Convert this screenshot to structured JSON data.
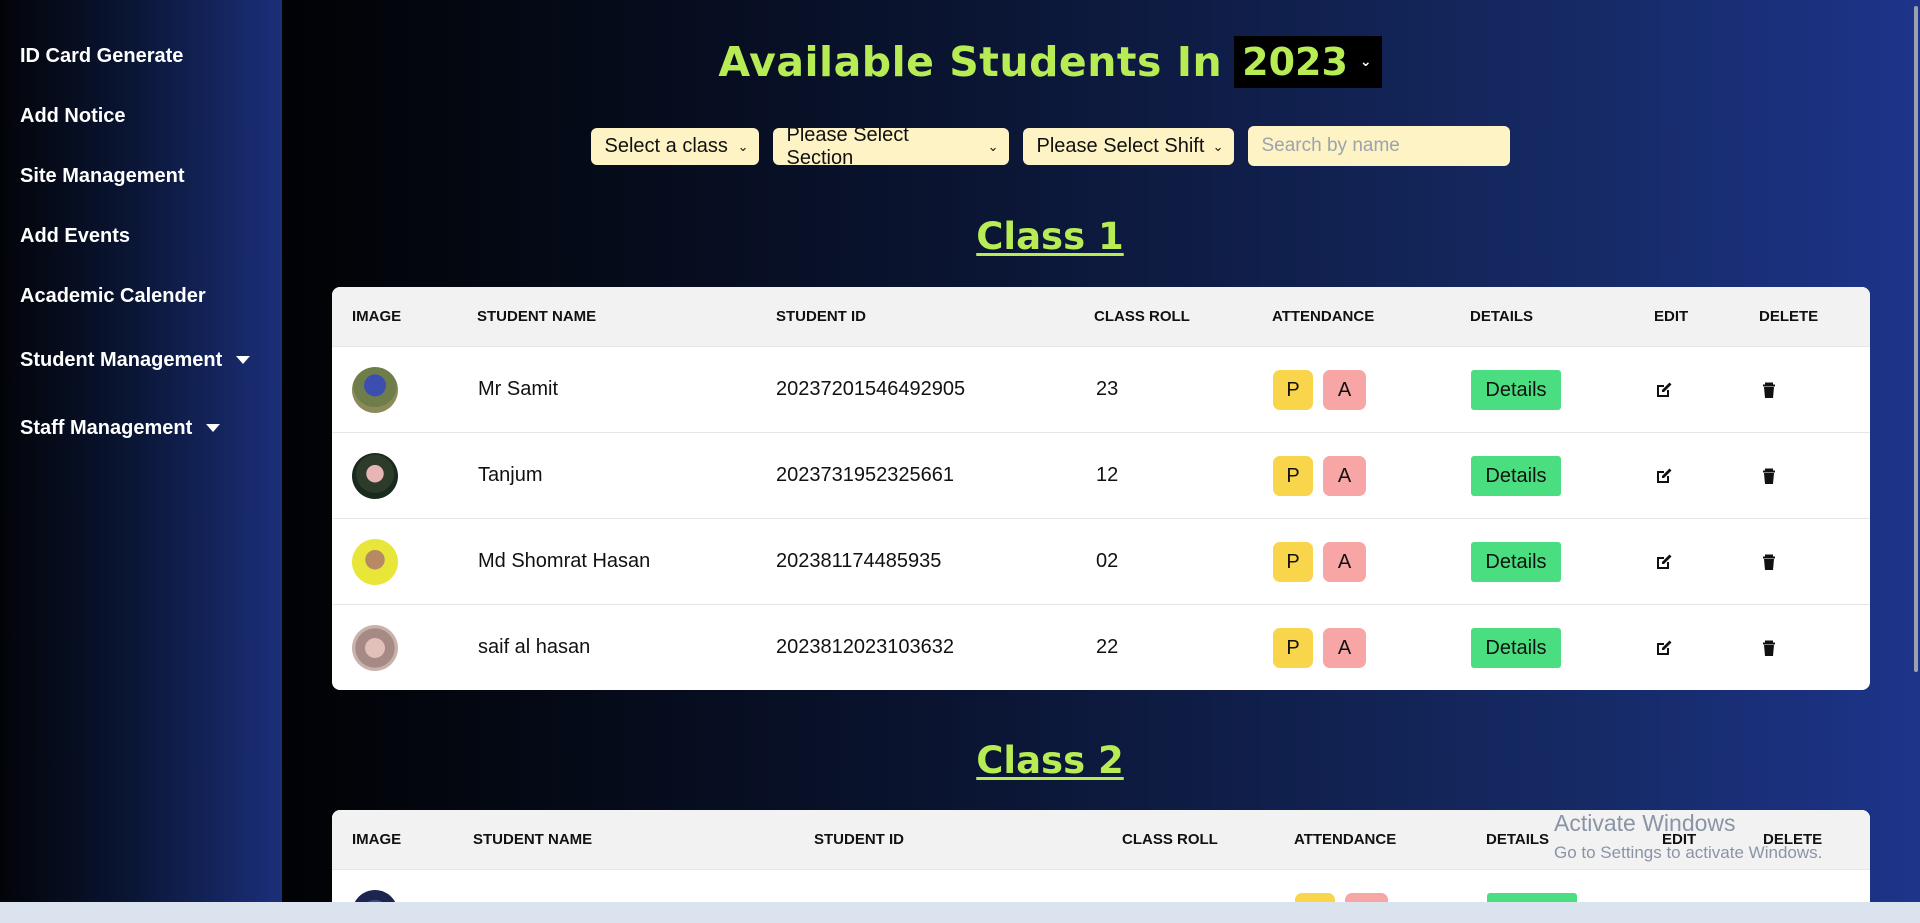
{
  "sidebar": {
    "items": [
      {
        "label": "ID Card Generate"
      },
      {
        "label": "Add Notice"
      },
      {
        "label": "Site Management"
      },
      {
        "label": "Add Events"
      },
      {
        "label": "Academic Calender"
      },
      {
        "label": "Student Management"
      },
      {
        "label": "Staff Management"
      }
    ]
  },
  "header": {
    "title": "Available Students In",
    "year": "2023"
  },
  "filters": {
    "class_select": "Select a class",
    "section_select": "Please Select Section",
    "shift_select": "Please Select Shift",
    "search_placeholder": "Search by name"
  },
  "columns": [
    "IMAGE",
    "STUDENT NAME",
    "STUDENT ID",
    "CLASS ROLL",
    "ATTENDANCE",
    "DETAILS",
    "EDIT",
    "DELETE"
  ],
  "class1": {
    "title": "Class 1",
    "rows": [
      {
        "name": "Mr Samit",
        "id": "20237201546492905",
        "roll": "23"
      },
      {
        "name": "Tanjum",
        "id": "2023731952325661",
        "roll": "12"
      },
      {
        "name": "Md Shomrat Hasan",
        "id": "202381174485935",
        "roll": "02"
      },
      {
        "name": "saif al hasan",
        "id": "2023812023103632",
        "roll": "22"
      }
    ]
  },
  "class2": {
    "title": "Class 2"
  },
  "buttons": {
    "present": "P",
    "absent": "A",
    "details": "Details"
  },
  "watermark": {
    "line1": "Activate Windows",
    "line2": "Go to Settings to activate Windows."
  },
  "colors": {
    "accent_green": "#b7ec55",
    "filter_bg": "#fef3c4",
    "present": "#f8d54a",
    "absent": "#f7a5a5",
    "details": "#4ade80"
  }
}
